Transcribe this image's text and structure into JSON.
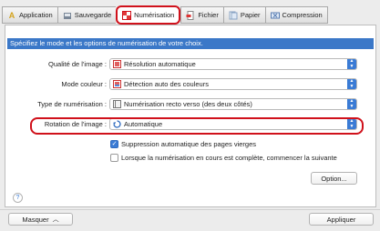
{
  "tabs": [
    {
      "label": "Application",
      "icon": "letter-a-icon",
      "active": false
    },
    {
      "label": "Sauvegarde",
      "icon": "save-folder-icon",
      "active": false
    },
    {
      "label": "Numérisation",
      "icon": "scan-grid-icon",
      "active": true
    },
    {
      "label": "Fichier",
      "icon": "file-icon",
      "active": false
    },
    {
      "label": "Papier",
      "icon": "paper-icon",
      "active": false
    },
    {
      "label": "Compression",
      "icon": "compression-icon",
      "active": false
    }
  ],
  "banner": "Spécifiez le mode et les options de numérisation de votre choix.",
  "fields": {
    "quality": {
      "label": "Qualité de l'image :",
      "value": "Résolution automatique"
    },
    "color_mode": {
      "label": "Mode couleur :",
      "value": "Détection auto des couleurs"
    },
    "scan_type": {
      "label": "Type de numérisation :",
      "value": "Numérisation recto verso (des deux côtés)"
    },
    "rotation": {
      "label": "Rotation de l'image :",
      "value": "Automatique"
    }
  },
  "checks": {
    "blank_pages": {
      "label": "Suppression automatique des pages vierges",
      "checked": true
    },
    "continue_scan": {
      "label": "Lorsque la numérisation en cours est complète, commencer la suivante",
      "checked": false
    }
  },
  "buttons": {
    "option": "Option...",
    "hide": "Masquer",
    "apply": "Appliquer",
    "help": "?"
  },
  "colors": {
    "accent": "#3a7bd5",
    "banner": "#3b78c8",
    "highlight": "#d0111b"
  }
}
